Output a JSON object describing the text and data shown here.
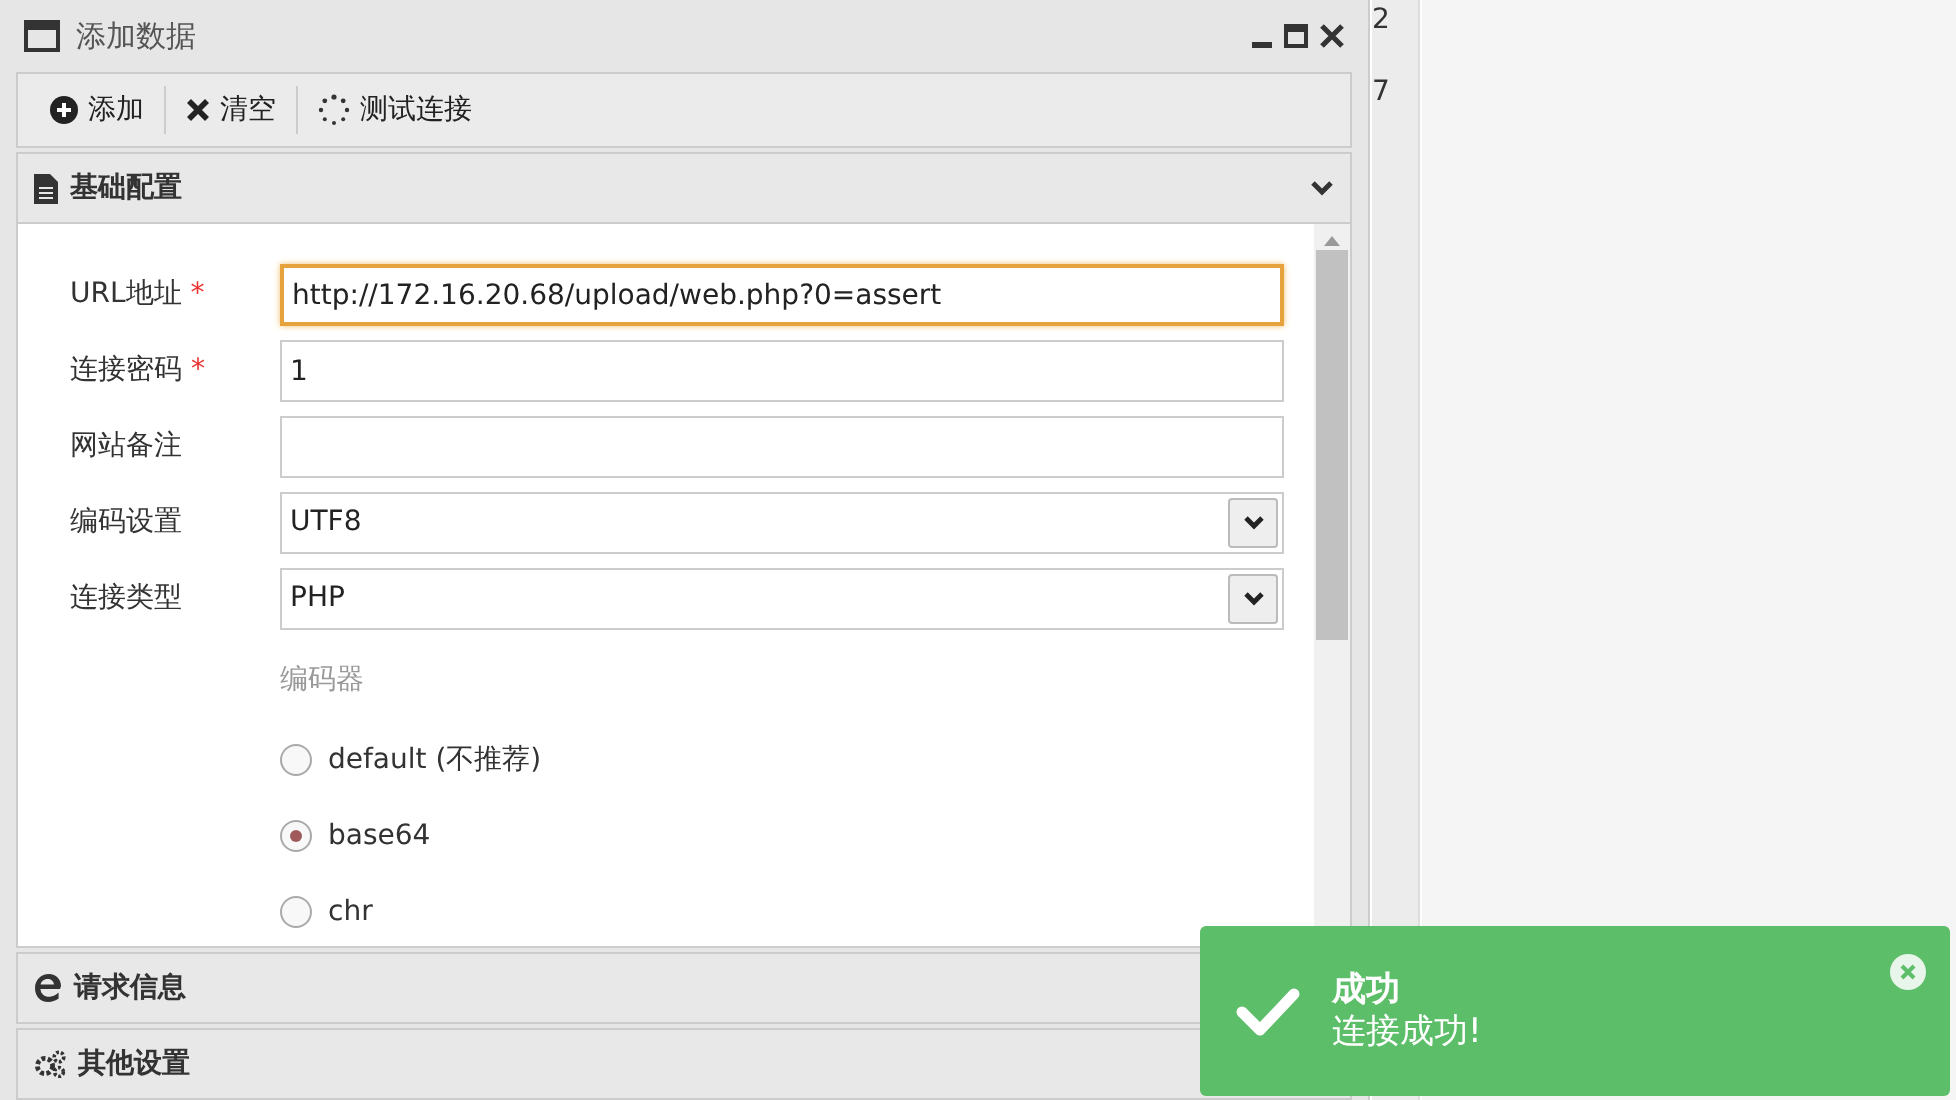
{
  "window": {
    "title": "添加数据"
  },
  "toolbar": [
    {
      "label": "添加"
    },
    {
      "label": "清空"
    },
    {
      "label": "测试连接"
    }
  ],
  "sections": [
    {
      "title": "基础配置",
      "expanded": true,
      "fields": [
        {
          "label": "URL地址",
          "required_mark": "*",
          "kind": "text",
          "value": "http://172.16.20.68/upload/web.php?0=assert",
          "focused": true
        },
        {
          "label": "连接密码",
          "required_mark": "*",
          "kind": "text",
          "value": "1",
          "focused": false
        },
        {
          "label": "网站备注",
          "kind": "text",
          "focused": false
        },
        {
          "label": "编码设置",
          "kind": "select",
          "value": "UTF8",
          "focused": false
        },
        {
          "label": "连接类型",
          "kind": "select",
          "value": "PHP",
          "focused": false
        }
      ],
      "encoder": {
        "title": "编码器",
        "options": [
          {
            "label": "default (不推荐)",
            "selected": false
          },
          {
            "label": "base64",
            "selected": true
          },
          {
            "label": "chr",
            "selected": false
          }
        ]
      }
    },
    {
      "title": "请求信息",
      "expanded": false
    },
    {
      "title": "其他设置",
      "expanded": false
    }
  ],
  "background_cells": [
    "2",
    "7"
  ],
  "toast": {
    "title": "成功",
    "message": "连接成功!"
  }
}
